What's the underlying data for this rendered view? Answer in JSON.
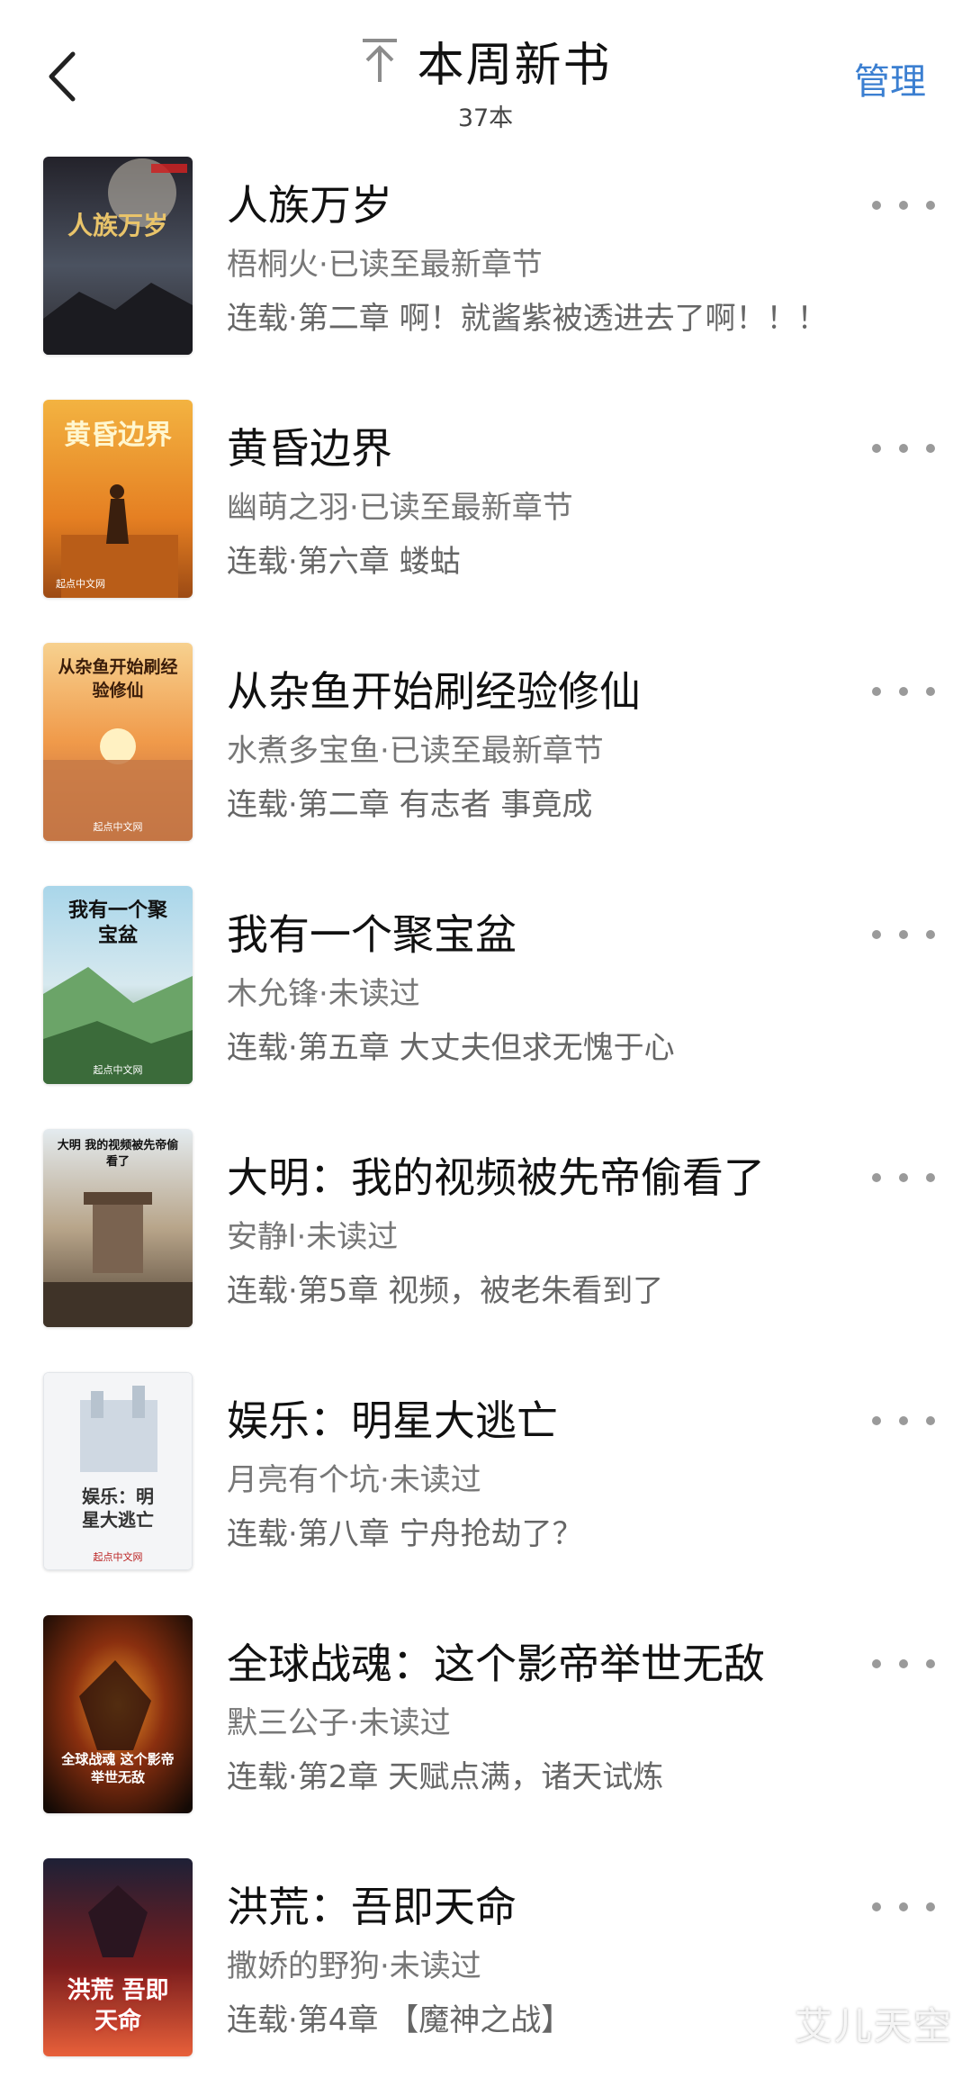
{
  "header": {
    "title": "本周新书",
    "count": "37本",
    "manage_label": "管理"
  },
  "books": [
    {
      "title": "人族万岁",
      "meta": "梧桐火·已读至最新章节",
      "chapter": "连载·第二章 啊！就酱紫被透进去了啊！！！",
      "cover_text": "人族万岁",
      "cover_colors": [
        "#2b2a30",
        "#4a4f5a",
        "#8a6a3a"
      ]
    },
    {
      "title": "黄昏边界",
      "meta": "幽萌之羽·已读至最新章节",
      "chapter": "连载·第六章 蝼蛄",
      "cover_text": "黄昏边界",
      "cover_sub": "起点中文网",
      "cover_colors": [
        "#f2a93b",
        "#e07b22",
        "#a84f12"
      ]
    },
    {
      "title": "从杂鱼开始刷经验修仙",
      "meta": "水煮多宝鱼·已读至最新章节",
      "chapter": "连载·第二章 有志者 事竟成",
      "cover_text": "从杂鱼开始刷经验修仙",
      "cover_sub": "起点中文网",
      "cover_colors": [
        "#f6c27a",
        "#ef9a4b",
        "#c0643a"
      ]
    },
    {
      "title": "我有一个聚宝盆",
      "meta": "木允锋·未读过",
      "chapter": "连载·第五章 大丈夫但求无愧于心",
      "cover_text": "我有一个聚宝盆",
      "cover_sub": "起点中文网",
      "cover_colors": [
        "#8fc7e0",
        "#6aa36a",
        "#3d6b3a"
      ]
    },
    {
      "title": "大明：我的视频被先帝偷看了",
      "meta": "安静l·未读过",
      "chapter": "连载·第5章 视频，被老朱看到了",
      "cover_text": "大明 我的视频被先帝偷看了",
      "cover_colors": [
        "#d9e3ea",
        "#a49179",
        "#5a4a3a"
      ]
    },
    {
      "title": "娱乐：明星大逃亡",
      "meta": "月亮有个坑·未读过",
      "chapter": "连载·第八章 宁舟抢劫了？",
      "cover_text": "娱乐：明星大逃亡",
      "cover_sub": "起点中文网",
      "cover_colors": [
        "#f3f4f6",
        "#dfe4ea",
        "#b7c3cf"
      ]
    },
    {
      "title": "全球战魂：这个影帝举世无敌",
      "meta": "默三公子·未读过",
      "chapter": "连载·第2章 天赋点满，诸天试炼",
      "cover_text": "全球战魂 这个影帝举世无敌",
      "cover_colors": [
        "#1b0f08",
        "#7a2b0e",
        "#e07a1f"
      ]
    },
    {
      "title": "洪荒：吾即天命",
      "meta": "撒娇的野狗·未读过",
      "chapter": "连载·第4章 【魔神之战】",
      "cover_text": "洪荒 吾即天命",
      "cover_colors": [
        "#1a1c2e",
        "#7a1d1d",
        "#e8603a"
      ]
    }
  ],
  "watermark": "艾儿天空"
}
